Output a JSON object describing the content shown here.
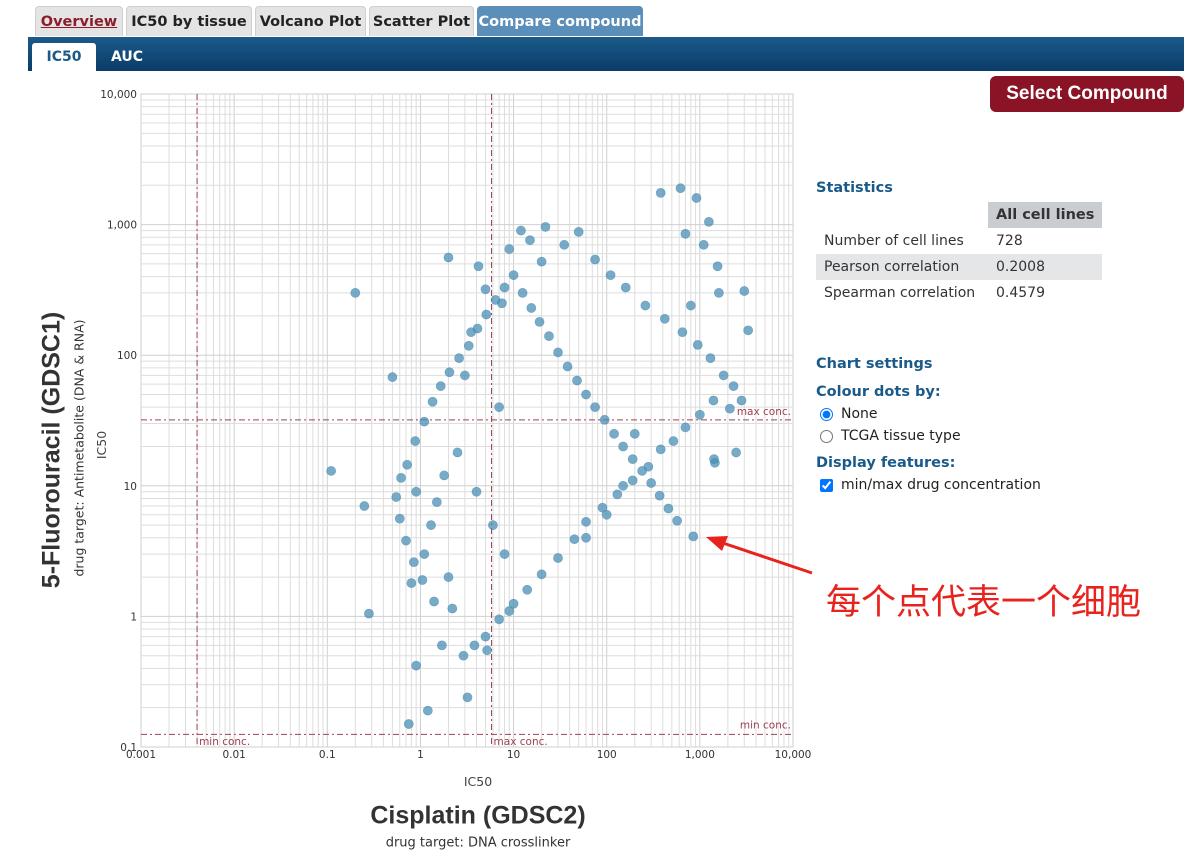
{
  "tabs": [
    {
      "label": "Overview"
    },
    {
      "label": "IC50 by tissue"
    },
    {
      "label": "Volcano Plot"
    },
    {
      "label": "Scatter Plot"
    },
    {
      "label": "Compare compound"
    }
  ],
  "subtabs": [
    {
      "label": "IC50"
    },
    {
      "label": "AUC"
    }
  ],
  "select_button": "Select Compound",
  "axes": {
    "y_title": "5-Fluorouracil (GDSC1)",
    "y_subtitle": "drug target: Antimetabolite (DNA & RNA)",
    "y_metric": "IC50",
    "x_title": "Cisplatin (GDSC2)",
    "x_subtitle": "drug target: DNA crosslinker",
    "x_metric": "IC50"
  },
  "stats": {
    "heading": "Statistics",
    "column": "All cell lines",
    "rows": [
      {
        "label": "Number of cell lines",
        "value": "728"
      },
      {
        "label": "Pearson correlation",
        "value": "0.2008"
      },
      {
        "label": "Spearman correlation",
        "value": "0.4579"
      }
    ]
  },
  "settings": {
    "heading": "Chart settings",
    "colour_heading": "Colour dots by:",
    "colour_options": [
      {
        "label": "None",
        "checked": true
      },
      {
        "label": "TCGA tissue type",
        "checked": false
      }
    ],
    "display_heading": "Display features:",
    "display_option": {
      "label": "min/max drug concentration",
      "checked": true
    }
  },
  "annotation": {
    "text": "每个点代表一个细胞",
    "color": "#e8231e"
  },
  "colors": {
    "dot": "#4a8fb5",
    "ref_line": "#a04050",
    "grid": "#dddddd",
    "header": "#0b3c68",
    "button": "#8a1426"
  },
  "chart_data": {
    "type": "scatter",
    "x_scale": "log",
    "y_scale": "log",
    "xlim": [
      0.001,
      10000
    ],
    "ylim": [
      0.1,
      10000
    ],
    "x_ticks": [
      "0.001",
      "0.01",
      "0.1",
      "1",
      "10",
      "100",
      "1,000",
      "10,000"
    ],
    "y_ticks": [
      "0.1",
      "1",
      "10",
      "100",
      "1,000",
      "10,000"
    ],
    "ref_lines": {
      "x_min": 0.004,
      "x_max": 5.8,
      "y_min": 0.125,
      "y_max": 32,
      "labels": {
        "x_min": "min conc.",
        "x_max": "max conc.",
        "y_min": "min conc.",
        "y_max": "max conc."
      }
    },
    "points": [
      [
        0.2,
        300
      ],
      [
        0.11,
        13
      ],
      [
        0.28,
        1.05
      ],
      [
        0.75,
        0.15
      ],
      [
        1.2,
        0.19
      ],
      [
        3.2,
        0.24
      ],
      [
        0.25,
        7
      ],
      [
        0.5,
        68
      ],
      [
        1.7,
        0.6
      ],
      [
        0.9,
        0.42
      ],
      [
        5.2,
        0.55
      ],
      [
        620,
        1900
      ],
      [
        380,
        1750
      ],
      [
        920,
        1600
      ],
      [
        1250,
        1050
      ],
      [
        700,
        850
      ],
      [
        1550,
        480
      ],
      [
        3000,
        310
      ],
      [
        3300,
        155
      ],
      [
        2100,
        39
      ],
      [
        2800,
        45
      ],
      [
        2450,
        18
      ],
      [
        1450,
        15
      ],
      [
        1420,
        16
      ],
      [
        850,
        4.1
      ],
      [
        1600,
        300
      ],
      [
        1100,
        700
      ],
      [
        800,
        240
      ],
      [
        200,
        25
      ],
      [
        150,
        10
      ],
      [
        100,
        6
      ],
      [
        60,
        4
      ],
      [
        1.3,
        5
      ],
      [
        2,
        2
      ],
      [
        0.9,
        9
      ],
      [
        1.8,
        12
      ],
      [
        3,
        70
      ],
      [
        6,
        5
      ],
      [
        7,
        40
      ],
      [
        8,
        3
      ],
      [
        9,
        1.1
      ],
      [
        0.8,
        1.8
      ],
      [
        1.1,
        3
      ],
      [
        1.5,
        7.5
      ],
      [
        2.5,
        18
      ],
      [
        4,
        9
      ],
      [
        3.5,
        150
      ],
      [
        2,
        560
      ],
      [
        4.2,
        480
      ],
      [
        5,
        320
      ],
      [
        7.5,
        250
      ],
      [
        9,
        650
      ],
      [
        12,
        900
      ],
      [
        15,
        760
      ],
      [
        20,
        520
      ],
      [
        22,
        960
      ],
      [
        35,
        700
      ],
      [
        50,
        880
      ],
      [
        75,
        540
      ],
      [
        110,
        410
      ],
      [
        160,
        330
      ],
      [
        260,
        240
      ],
      [
        420,
        190
      ],
      [
        650,
        150
      ],
      [
        950,
        120
      ],
      [
        1300,
        95
      ],
      [
        1800,
        70
      ],
      [
        2300,
        58
      ],
      [
        1400,
        45
      ],
      [
        1000,
        35
      ],
      [
        700,
        28
      ],
      [
        520,
        22
      ],
      [
        380,
        19
      ],
      [
        280,
        14
      ],
      [
        190,
        11
      ],
      [
        130,
        8.6
      ],
      [
        90,
        6.8
      ],
      [
        60,
        5.3
      ],
      [
        45,
        3.9
      ],
      [
        30,
        2.8
      ],
      [
        20,
        2.1
      ],
      [
        14,
        1.6
      ],
      [
        10,
        1.25
      ],
      [
        7,
        0.95
      ],
      [
        5,
        0.7
      ],
      [
        3.8,
        0.6
      ],
      [
        2.9,
        0.5
      ],
      [
        2.2,
        1.15
      ],
      [
        1.4,
        1.3
      ],
      [
        1.05,
        1.9
      ],
      [
        0.85,
        2.6
      ],
      [
        0.7,
        3.8
      ],
      [
        0.6,
        5.6
      ],
      [
        0.55,
        8.2
      ],
      [
        0.62,
        11.5
      ],
      [
        0.72,
        14.5
      ],
      [
        0.88,
        22
      ],
      [
        1.1,
        31
      ],
      [
        1.35,
        44
      ],
      [
        1.65,
        58
      ],
      [
        2.05,
        74
      ],
      [
        2.6,
        95
      ],
      [
        3.3,
        118
      ],
      [
        4.1,
        160
      ],
      [
        5.1,
        205
      ],
      [
        6.4,
        265
      ],
      [
        8,
        330
      ],
      [
        10,
        410
      ],
      [
        12.5,
        300
      ],
      [
        15.5,
        230
      ],
      [
        19,
        180
      ],
      [
        24,
        140
      ],
      [
        30,
        105
      ],
      [
        38,
        82
      ],
      [
        48,
        64
      ],
      [
        60,
        50
      ],
      [
        75,
        40
      ],
      [
        95,
        32
      ],
      [
        120,
        25
      ],
      [
        150,
        20
      ],
      [
        190,
        16
      ],
      [
        240,
        13
      ],
      [
        300,
        10.5
      ],
      [
        370,
        8.4
      ],
      [
        460,
        6.7
      ],
      [
        570,
        5.4
      ]
    ]
  }
}
